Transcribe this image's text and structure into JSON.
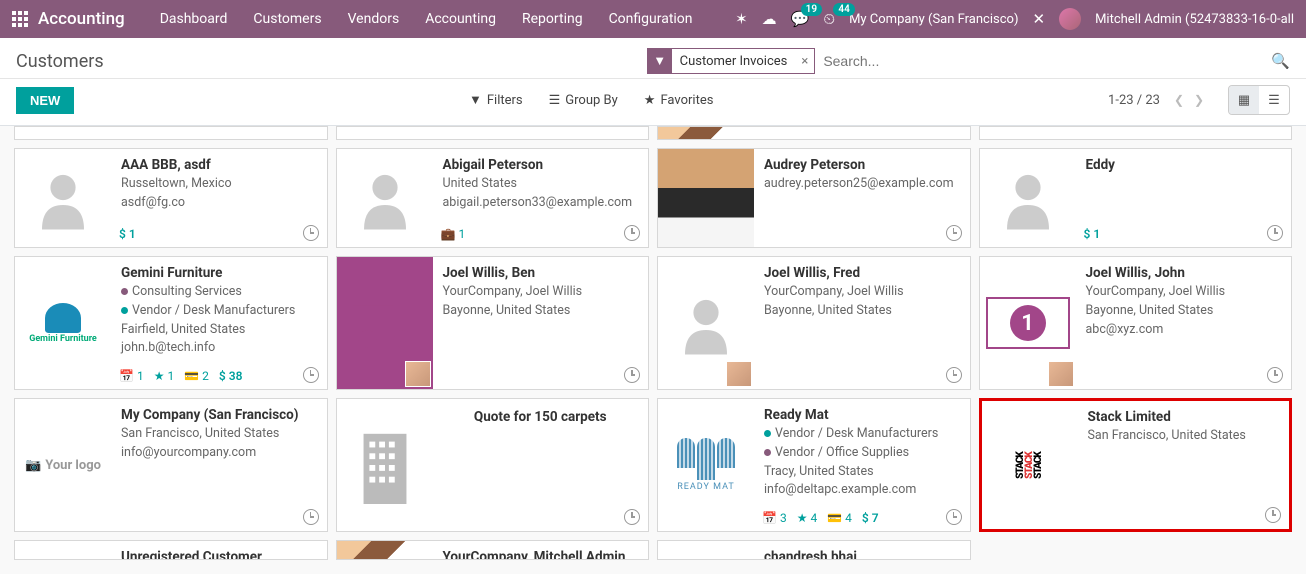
{
  "topbar": {
    "brand": "Accounting",
    "nav": [
      "Dashboard",
      "Customers",
      "Vendors",
      "Accounting",
      "Reporting",
      "Configuration"
    ],
    "chat_badge": "19",
    "activity_badge": "44",
    "company": "My Company (San Francisco)",
    "user": "Mitchell Admin (52473833-16-0-all"
  },
  "header": {
    "title": "Customers",
    "facet": "Customer Invoices",
    "search_placeholder": "Search..."
  },
  "toolbar": {
    "new_label": "NEW",
    "filters": "Filters",
    "groupby": "Group By",
    "favorites": "Favorites",
    "pager": "1-23 / 23"
  },
  "cards": [
    {
      "title": "AAA BBB, asdf",
      "l1": "Russeltown, Mexico",
      "l2": "asdf@fg.co",
      "money": "$ 1"
    },
    {
      "title": "Abigail Peterson",
      "l1": "United States",
      "l2": "abigail.peterson33@example.com",
      "briefcase": "1"
    },
    {
      "title": "Audrey Peterson",
      "l1": "audrey.peterson25@example.com"
    },
    {
      "title": "Eddy",
      "money": "$ 1"
    },
    {
      "title": "Gemini Furniture",
      "tag1": "Consulting Services",
      "tag2": "Vendor / Desk Manufacturers",
      "l1": "Fairfield, United States",
      "l2": "john.b@tech.info",
      "cal": "1",
      "star": "1",
      "card_i": "2",
      "money": "$ 38"
    },
    {
      "title": "Joel Willis, Ben",
      "l1": "YourCompany, Joel Willis",
      "l2": "Bayonne, United States"
    },
    {
      "title": "Joel Willis, Fred",
      "l1": "YourCompany, Joel Willis",
      "l2": "Bayonne, United States"
    },
    {
      "title": "Joel Willis, John",
      "l1": "YourCompany, Joel Willis",
      "l2": "Bayonne, United States",
      "l3": "abc@xyz.com"
    },
    {
      "title": "My Company (San Francisco)",
      "l1": "San Francisco, United States",
      "l2": "info@yourcompany.com",
      "logo_text": "Your logo"
    },
    {
      "title": "Quote for 150 carpets"
    },
    {
      "title": "Ready Mat",
      "tag1": "Vendor / Desk Manufacturers",
      "tag2": "Vendor / Office Supplies",
      "l1": "Tracy, United States",
      "l2": "info@deltapc.example.com",
      "cal": "3",
      "star": "4",
      "card_i": "4",
      "money": "$ 7",
      "readytext": "READY MAT"
    },
    {
      "title": "Stack Limited",
      "l1": "San Francisco, United States",
      "stack1": "STACK",
      "stack2": "STACK",
      "stack3": "STACK"
    },
    {
      "title": "Unregistered Customer"
    },
    {
      "title": "YourCompany, Mitchell Admin"
    },
    {
      "title": "chandresh bhai"
    },
    {
      "gemini_text": "Gemini Furniture"
    }
  ]
}
